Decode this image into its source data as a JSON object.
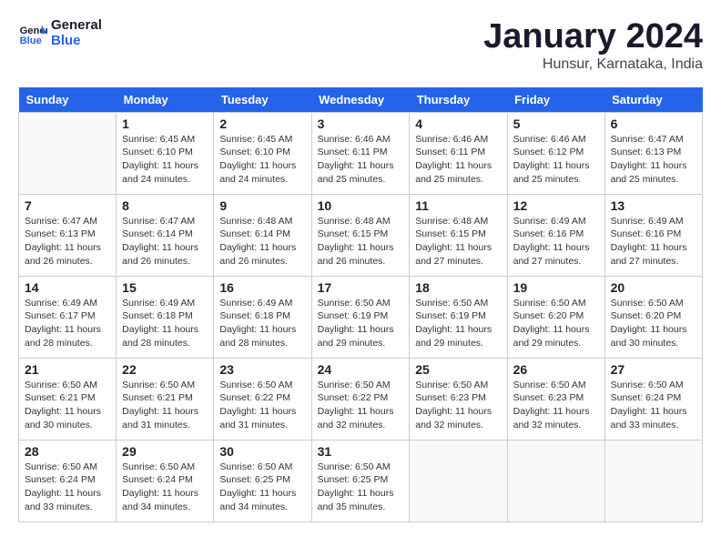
{
  "header": {
    "logo_line1": "General",
    "logo_line2": "Blue",
    "title": "January 2024",
    "subtitle": "Hunsur, Karnataka, India"
  },
  "days": [
    "Sunday",
    "Monday",
    "Tuesday",
    "Wednesday",
    "Thursday",
    "Friday",
    "Saturday"
  ],
  "weeks": [
    [
      {
        "date": "",
        "info": ""
      },
      {
        "date": "1",
        "info": "Sunrise: 6:45 AM\nSunset: 6:10 PM\nDaylight: 11 hours\nand 24 minutes."
      },
      {
        "date": "2",
        "info": "Sunrise: 6:45 AM\nSunset: 6:10 PM\nDaylight: 11 hours\nand 24 minutes."
      },
      {
        "date": "3",
        "info": "Sunrise: 6:46 AM\nSunset: 6:11 PM\nDaylight: 11 hours\nand 25 minutes."
      },
      {
        "date": "4",
        "info": "Sunrise: 6:46 AM\nSunset: 6:11 PM\nDaylight: 11 hours\nand 25 minutes."
      },
      {
        "date": "5",
        "info": "Sunrise: 6:46 AM\nSunset: 6:12 PM\nDaylight: 11 hours\nand 25 minutes."
      },
      {
        "date": "6",
        "info": "Sunrise: 6:47 AM\nSunset: 6:13 PM\nDaylight: 11 hours\nand 25 minutes."
      }
    ],
    [
      {
        "date": "7",
        "info": "Sunrise: 6:47 AM\nSunset: 6:13 PM\nDaylight: 11 hours\nand 26 minutes."
      },
      {
        "date": "8",
        "info": "Sunrise: 6:47 AM\nSunset: 6:14 PM\nDaylight: 11 hours\nand 26 minutes."
      },
      {
        "date": "9",
        "info": "Sunrise: 6:48 AM\nSunset: 6:14 PM\nDaylight: 11 hours\nand 26 minutes."
      },
      {
        "date": "10",
        "info": "Sunrise: 6:48 AM\nSunset: 6:15 PM\nDaylight: 11 hours\nand 26 minutes."
      },
      {
        "date": "11",
        "info": "Sunrise: 6:48 AM\nSunset: 6:15 PM\nDaylight: 11 hours\nand 27 minutes."
      },
      {
        "date": "12",
        "info": "Sunrise: 6:49 AM\nSunset: 6:16 PM\nDaylight: 11 hours\nand 27 minutes."
      },
      {
        "date": "13",
        "info": "Sunrise: 6:49 AM\nSunset: 6:16 PM\nDaylight: 11 hours\nand 27 minutes."
      }
    ],
    [
      {
        "date": "14",
        "info": "Sunrise: 6:49 AM\nSunset: 6:17 PM\nDaylight: 11 hours\nand 28 minutes."
      },
      {
        "date": "15",
        "info": "Sunrise: 6:49 AM\nSunset: 6:18 PM\nDaylight: 11 hours\nand 28 minutes."
      },
      {
        "date": "16",
        "info": "Sunrise: 6:49 AM\nSunset: 6:18 PM\nDaylight: 11 hours\nand 28 minutes."
      },
      {
        "date": "17",
        "info": "Sunrise: 6:50 AM\nSunset: 6:19 PM\nDaylight: 11 hours\nand 29 minutes."
      },
      {
        "date": "18",
        "info": "Sunrise: 6:50 AM\nSunset: 6:19 PM\nDaylight: 11 hours\nand 29 minutes."
      },
      {
        "date": "19",
        "info": "Sunrise: 6:50 AM\nSunset: 6:20 PM\nDaylight: 11 hours\nand 29 minutes."
      },
      {
        "date": "20",
        "info": "Sunrise: 6:50 AM\nSunset: 6:20 PM\nDaylight: 11 hours\nand 30 minutes."
      }
    ],
    [
      {
        "date": "21",
        "info": "Sunrise: 6:50 AM\nSunset: 6:21 PM\nDaylight: 11 hours\nand 30 minutes."
      },
      {
        "date": "22",
        "info": "Sunrise: 6:50 AM\nSunset: 6:21 PM\nDaylight: 11 hours\nand 31 minutes."
      },
      {
        "date": "23",
        "info": "Sunrise: 6:50 AM\nSunset: 6:22 PM\nDaylight: 11 hours\nand 31 minutes."
      },
      {
        "date": "24",
        "info": "Sunrise: 6:50 AM\nSunset: 6:22 PM\nDaylight: 11 hours\nand 32 minutes."
      },
      {
        "date": "25",
        "info": "Sunrise: 6:50 AM\nSunset: 6:23 PM\nDaylight: 11 hours\nand 32 minutes."
      },
      {
        "date": "26",
        "info": "Sunrise: 6:50 AM\nSunset: 6:23 PM\nDaylight: 11 hours\nand 32 minutes."
      },
      {
        "date": "27",
        "info": "Sunrise: 6:50 AM\nSunset: 6:24 PM\nDaylight: 11 hours\nand 33 minutes."
      }
    ],
    [
      {
        "date": "28",
        "info": "Sunrise: 6:50 AM\nSunset: 6:24 PM\nDaylight: 11 hours\nand 33 minutes."
      },
      {
        "date": "29",
        "info": "Sunrise: 6:50 AM\nSunset: 6:24 PM\nDaylight: 11 hours\nand 34 minutes."
      },
      {
        "date": "30",
        "info": "Sunrise: 6:50 AM\nSunset: 6:25 PM\nDaylight: 11 hours\nand 34 minutes."
      },
      {
        "date": "31",
        "info": "Sunrise: 6:50 AM\nSunset: 6:25 PM\nDaylight: 11 hours\nand 35 minutes."
      },
      {
        "date": "",
        "info": ""
      },
      {
        "date": "",
        "info": ""
      },
      {
        "date": "",
        "info": ""
      }
    ]
  ]
}
